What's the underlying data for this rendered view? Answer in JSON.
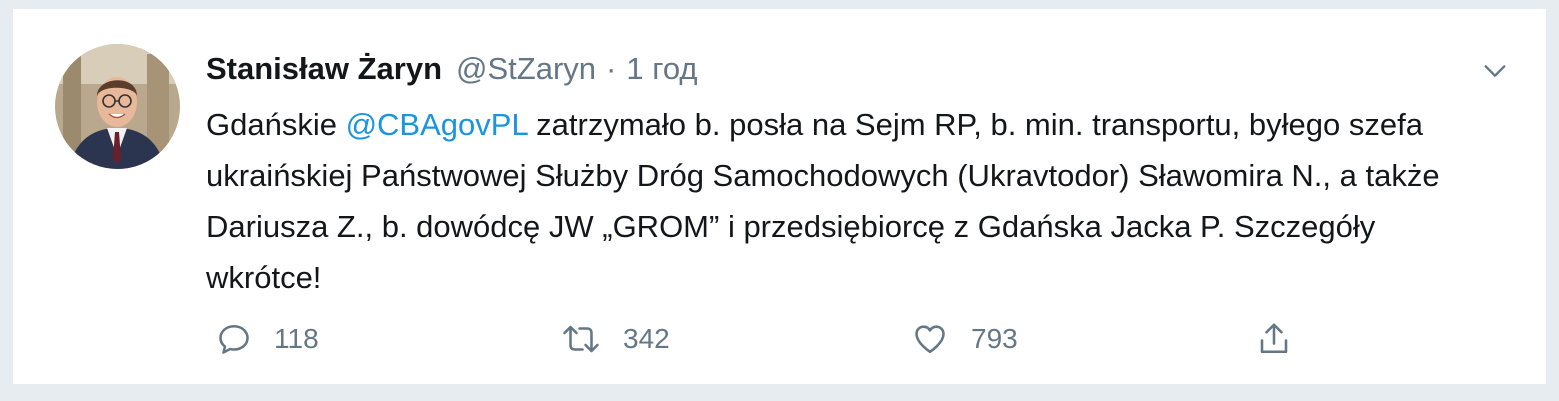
{
  "tweet": {
    "author_name": "Stanisław Żaryn",
    "handle": "@StZaryn",
    "separator": "·",
    "time": "1 год",
    "text_part1": "Gdańskie ",
    "mention": "@CBAgovPL",
    "text_part2": " zatrzymało b. posła na Sejm RP, b. min. transportu, byłego szefa ukraińskiej Państwowej Służby Dróg Samochodowych (Ukravtodor) Sławomira N., a także Dariusza Z., b. dowódcę JW „GROM” i przedsiębiorcę z Gdańska Jacka P. Szczegóły wkrótce!",
    "replies": "118",
    "retweets": "342",
    "likes": "793"
  },
  "icons": {
    "reply": "speech-bubble-icon",
    "retweet": "retweet-icon",
    "like": "heart-icon",
    "share": "share-icon",
    "menu": "chevron-down-icon"
  },
  "colors": {
    "text": "#14171a",
    "secondary": "#657786",
    "link": "#1b95e0",
    "background": "#e6ecf0"
  }
}
